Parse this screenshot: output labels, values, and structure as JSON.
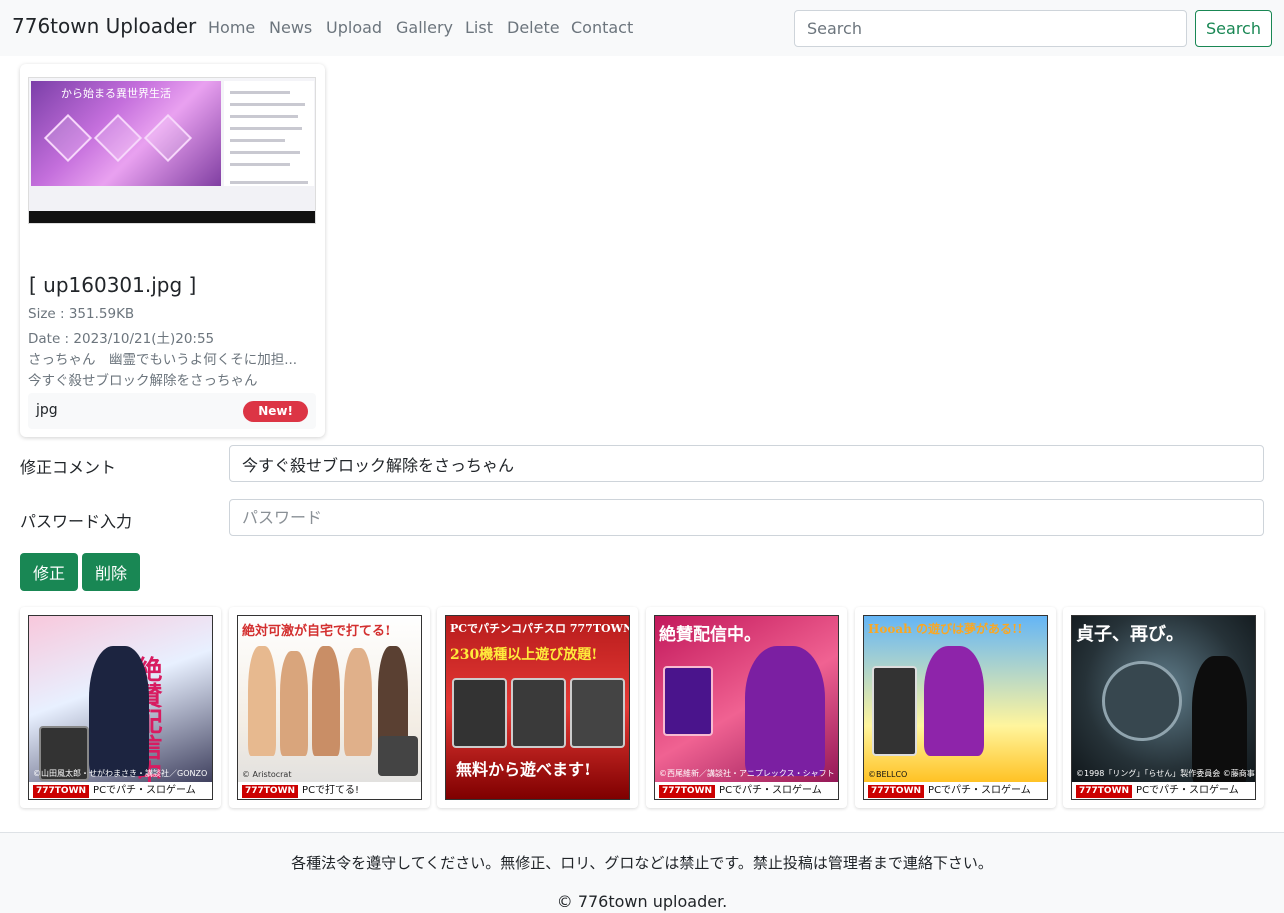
{
  "navbar": {
    "brand": "776town Uploader",
    "links": [
      "Home",
      "News",
      "Upload",
      "Gallery",
      "List",
      "Delete",
      "Contact"
    ],
    "search_placeholder": "Search",
    "search_button": "Search"
  },
  "card": {
    "thumbnail_caption": "から始まる異世界生活",
    "title": "[ up160301.jpg ]",
    "size": "Size : 351.59KB",
    "date": "Date : 2023/10/21(土)20:55",
    "comment_line1": "さっちゃん　幽霊でもいうよ何くそに加担...",
    "comment_line2": "今すぐ殺せブロック解除をさっちゃん",
    "extension": "jpg",
    "badge": "New!"
  },
  "form": {
    "comment_label": "修正コメント",
    "comment_value": "今すぐ殺せブロック解除をさっちゃん",
    "password_label": "パスワード入力",
    "password_placeholder": "パスワード",
    "edit_button": "修正",
    "delete_button": "削除"
  },
  "ads": [
    {
      "headline": "絶賛配信中",
      "copy": "©山田風太郎・せがわまさき・講談社／GONZO",
      "logo": "777TOWN",
      "tagline": "PCでパチ・スロゲーム",
      "accent": "#d81b60"
    },
    {
      "headline": "絶対可激が自宅で打てる!",
      "copy": "© Aristocrat",
      "logo": "777TOWN",
      "tagline": "PCで打てる!",
      "accent": "#e53935"
    },
    {
      "headline": "PCでパチンコパチスロ 777TOWN",
      "copy": "無料から遊べます!",
      "logo": "777TOWN",
      "tagline": "230機種以上遊び放題!",
      "accent": "#c62828"
    },
    {
      "headline": "絶賛配信中。",
      "copy": "©西尾維新／講談社・アニプレックス・シャフト ©Sammy",
      "logo": "777TOWN",
      "tagline": "PCでパチ・スロゲーム",
      "accent": "#e91e63"
    },
    {
      "headline": "Hooah の遊びは夢がある!!",
      "copy": "©BELLCO",
      "logo": "777TOWN",
      "tagline": "PCでパチ・スロゲーム",
      "accent": "#1565c0"
    },
    {
      "headline": "貞子、再び。",
      "copy": "©1998「リング」「らせん」製作委員会 ©藤商事",
      "logo": "777TOWN",
      "tagline": "PCでパチ・スロゲーム",
      "accent": "#37474f"
    }
  ],
  "footer": {
    "notice": "各種法令を遵守してください。無修正、ロリ、グロなどは禁止です。禁止投稿は管理者まで連絡下さい。",
    "copyright": "© 776town uploader."
  }
}
